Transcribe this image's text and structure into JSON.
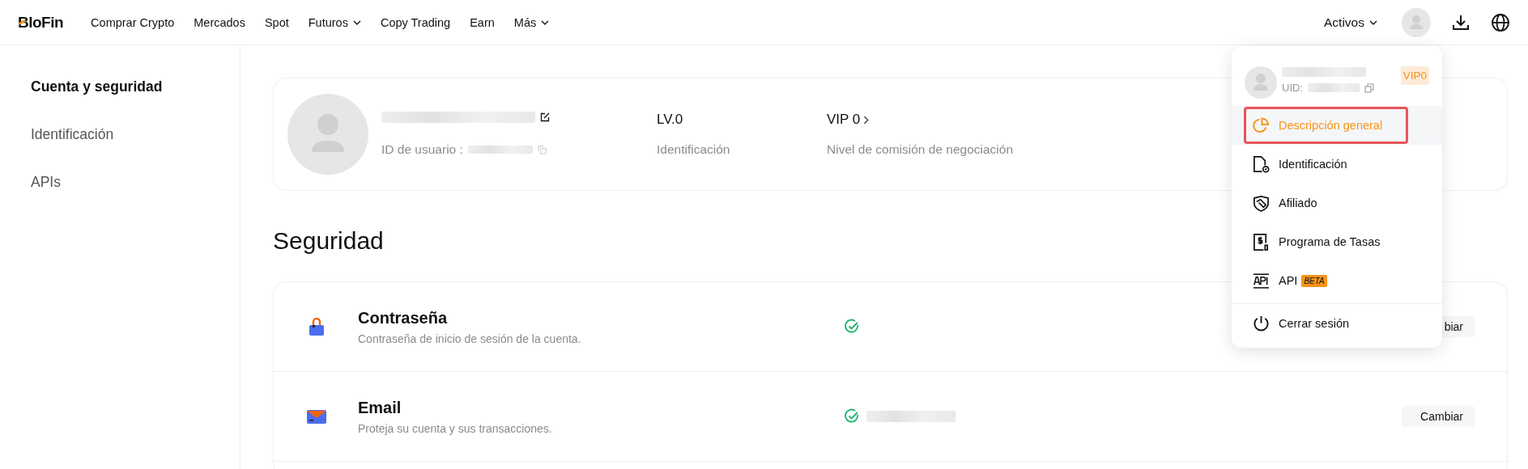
{
  "logo": "BloFin",
  "nav": [
    {
      "label": "Comprar Crypto",
      "dropdown": false
    },
    {
      "label": "Mercados",
      "dropdown": false
    },
    {
      "label": "Spot",
      "dropdown": false
    },
    {
      "label": "Futuros",
      "dropdown": true
    },
    {
      "label": "Copy Trading",
      "dropdown": false
    },
    {
      "label": "Earn",
      "dropdown": false
    },
    {
      "label": "Más",
      "dropdown": true
    }
  ],
  "header_right": {
    "assets": "Activos"
  },
  "sidebar": {
    "items": [
      {
        "label": "Cuenta y seguridad",
        "selected": true
      },
      {
        "label": "Identificación",
        "selected": false
      },
      {
        "label": "APIs",
        "selected": false
      }
    ]
  },
  "profile": {
    "user_id_label": "ID de usuario :",
    "stats": [
      {
        "value": "LV.0",
        "label": "Identificación",
        "link": false
      },
      {
        "value": "VIP 0",
        "label": "Nivel de comisión de negociación",
        "link": true
      }
    ]
  },
  "security": {
    "title": "Seguridad",
    "rows": [
      {
        "kind": "lock",
        "title": "Contraseña",
        "description": "Contraseña de inicio de sesión de la cuenta.",
        "verified": true,
        "masked_value": false,
        "button": "biar"
      },
      {
        "kind": "email",
        "title": "Email",
        "description": "Proteja su cuenta y sus transacciones.",
        "verified": true,
        "masked_value": true,
        "button": "Cambiar"
      }
    ]
  },
  "account_menu": {
    "uid_label": "UID:",
    "vip_badge": "VIP0",
    "items": [
      {
        "kind": "overview",
        "label": "Descripción general",
        "selected": true
      },
      {
        "kind": "id",
        "label": "Identificación",
        "selected": false
      },
      {
        "kind": "handshake",
        "label": "Afiliado",
        "selected": false
      },
      {
        "kind": "fees",
        "label": "Programa de Tasas",
        "selected": false
      },
      {
        "kind": "api",
        "label": "API",
        "badge": "BETA",
        "selected": false
      }
    ],
    "logout": "Cerrar sesión"
  }
}
